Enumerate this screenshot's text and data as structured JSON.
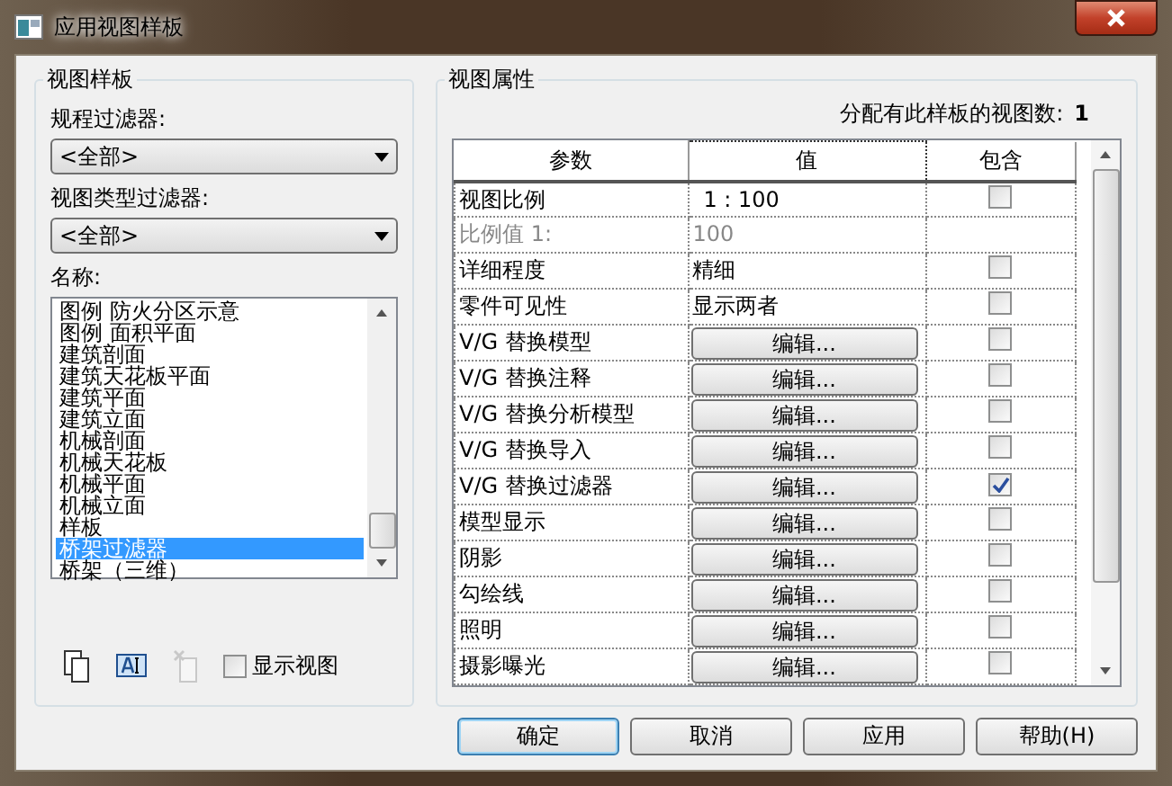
{
  "window": {
    "title": "应用视图样板"
  },
  "template_panel": {
    "title": "视图样板",
    "discipline_filter": {
      "label": "规程过滤器:",
      "value": "<全部>"
    },
    "view_type_filter": {
      "label": "视图类型过滤器:",
      "value": "<全部>"
    },
    "names": {
      "label": "名称:",
      "items": [
        {
          "text": "图例 防火分区示意",
          "selected": false
        },
        {
          "text": "图例 面积平面",
          "selected": false
        },
        {
          "text": "建筑剖面",
          "selected": false
        },
        {
          "text": "建筑天花板平面",
          "selected": false
        },
        {
          "text": "建筑平面",
          "selected": false
        },
        {
          "text": "建筑立面",
          "selected": false
        },
        {
          "text": "机械剖面",
          "selected": false
        },
        {
          "text": "机械天花板",
          "selected": false
        },
        {
          "text": "机械平面",
          "selected": false
        },
        {
          "text": "机械立面",
          "selected": false
        },
        {
          "text": "样板",
          "selected": false
        },
        {
          "text": "桥架过滤器",
          "selected": true
        },
        {
          "text": "桥架（三维）",
          "selected": false
        }
      ]
    },
    "tools": [
      {
        "kind": "duplicate",
        "disabled": false
      },
      {
        "kind": "rename",
        "disabled": false
      },
      {
        "kind": "delete",
        "disabled": true
      }
    ],
    "show_views": {
      "label": "显示视图",
      "checked": false
    }
  },
  "properties_panel": {
    "title": "视图属性",
    "view_count": {
      "label": "分配有此样板的视图数:",
      "value": "1"
    },
    "columns": [
      "参数",
      "值",
      "包含"
    ],
    "rows": [
      {
        "parameter": "视图比例",
        "kind": "text",
        "value": "1 : 100",
        "disabled": false,
        "include": false
      },
      {
        "parameter": "比例值 1:",
        "kind": "text",
        "value": "100",
        "disabled": true
      },
      {
        "parameter": "详细程度",
        "kind": "text",
        "value": "精细",
        "disabled": false,
        "include": false
      },
      {
        "parameter": "零件可见性",
        "kind": "text",
        "value": "显示两者",
        "disabled": false,
        "include": false
      },
      {
        "parameter": "V/G 替换模型",
        "kind": "button",
        "value": "编辑...",
        "disabled": false,
        "include": false
      },
      {
        "parameter": "V/G 替换注释",
        "kind": "button",
        "value": "编辑...",
        "disabled": false,
        "include": false
      },
      {
        "parameter": "V/G 替换分析模型",
        "kind": "button",
        "value": "编辑...",
        "disabled": false,
        "include": false
      },
      {
        "parameter": "V/G 替换导入",
        "kind": "button",
        "value": "编辑...",
        "disabled": false,
        "include": false
      },
      {
        "parameter": "V/G 替换过滤器",
        "kind": "button",
        "value": "编辑...",
        "disabled": false,
        "include": true
      },
      {
        "parameter": "模型显示",
        "kind": "button",
        "value": "编辑...",
        "disabled": false,
        "include": false
      },
      {
        "parameter": "阴影",
        "kind": "button",
        "value": "编辑...",
        "disabled": false,
        "include": false
      },
      {
        "parameter": "勾绘线",
        "kind": "button",
        "value": "编辑...",
        "disabled": false,
        "include": false
      },
      {
        "parameter": "照明",
        "kind": "button",
        "value": "编辑...",
        "disabled": false,
        "include": false
      },
      {
        "parameter": "摄影曝光",
        "kind": "button",
        "value": "编辑...",
        "disabled": false,
        "include": false
      }
    ]
  },
  "buttons": [
    {
      "label": "确定",
      "default": true
    },
    {
      "label": "取消",
      "default": false
    },
    {
      "label": "应用",
      "default": false
    },
    {
      "label": "帮助(H)",
      "default": false
    }
  ]
}
